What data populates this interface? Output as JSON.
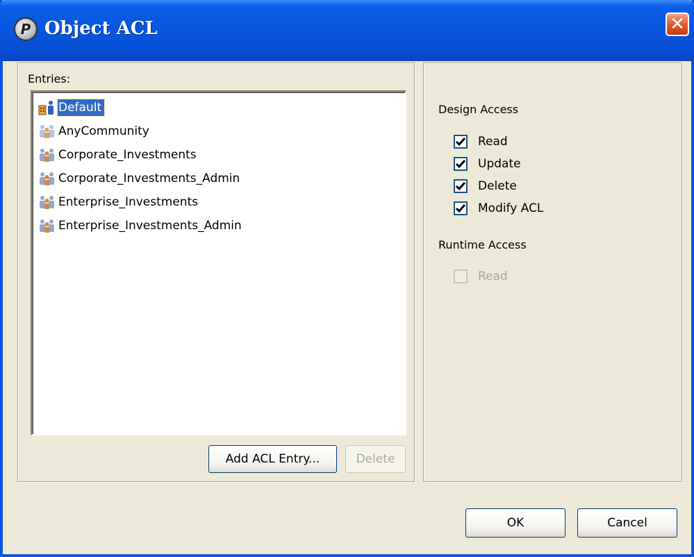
{
  "window": {
    "title": "Object ACL",
    "close_glyph": "✕",
    "logo_glyph": "P"
  },
  "entries": {
    "label": "Entries:",
    "items": [
      {
        "label": "Default",
        "icon": "user-group-default-icon",
        "selected": true
      },
      {
        "label": "AnyCommunity",
        "icon": "community-icon",
        "selected": false
      },
      {
        "label": "Corporate_Investments",
        "icon": "group-icon",
        "selected": false
      },
      {
        "label": "Corporate_Investments_Admin",
        "icon": "group-icon",
        "selected": false
      },
      {
        "label": "Enterprise_Investments",
        "icon": "group-icon",
        "selected": false
      },
      {
        "label": "Enterprise_Investments_Admin",
        "icon": "group-icon",
        "selected": false
      }
    ],
    "add_button": "Add ACL Entry...",
    "delete_button": "Delete"
  },
  "design_access": {
    "heading": "Design Access",
    "options": [
      {
        "label": "Read",
        "checked": true
      },
      {
        "label": "Update",
        "checked": true
      },
      {
        "label": "Delete",
        "checked": true
      },
      {
        "label": "Modify ACL",
        "checked": true
      }
    ]
  },
  "runtime_access": {
    "heading": "Runtime Access",
    "options": [
      {
        "label": "Read",
        "checked": false,
        "disabled": true
      }
    ]
  },
  "footer": {
    "ok": "OK",
    "cancel": "Cancel"
  },
  "colors": {
    "title_bar": "#0855dd",
    "selection": "#316ac5",
    "dialog_bg": "#ece9d8"
  }
}
